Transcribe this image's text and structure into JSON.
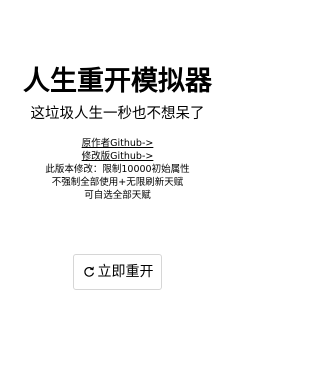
{
  "header": {
    "title": "人生重开模拟器",
    "subtitle": "这垃圾人生一秒也不想呆了"
  },
  "links": {
    "original": "原作者Github->",
    "modified": "修改版Github->"
  },
  "notes": [
    "此版本修改：限制10000初始属性",
    "不强制全部使用+无限刷新天赋",
    "可自选全部天赋"
  ],
  "restart_button": {
    "icon": "restart-icon",
    "label": "立即重开"
  }
}
